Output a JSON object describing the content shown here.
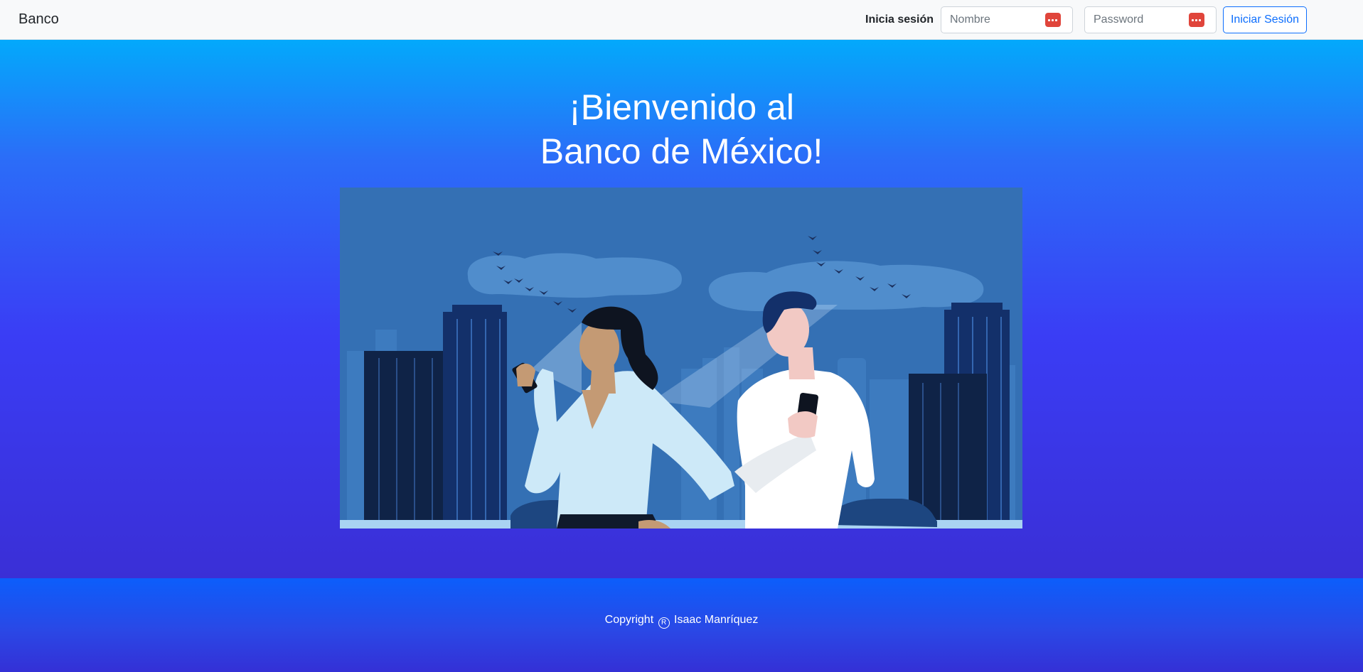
{
  "navbar": {
    "brand": "Banco",
    "login_label": "Inicia sesión",
    "name_placeholder": "Nombre",
    "password_placeholder": "Password",
    "login_button": "Iniciar Sesión",
    "icon": "password-manager-icon",
    "icon_color": "#e0453b",
    "button_color": "#0d6efd"
  },
  "hero": {
    "title_line1": "¡Bienvenido al",
    "title_line2": "Banco de México!",
    "image": "people-with-smartphones-city-illustration",
    "gradient_top": "#03a9fb",
    "gradient_bottom": "#3a2fd6"
  },
  "footer": {
    "copyright_label": "Copyright",
    "copyright_symbol": "R",
    "author": "Isaac Manríquez"
  }
}
